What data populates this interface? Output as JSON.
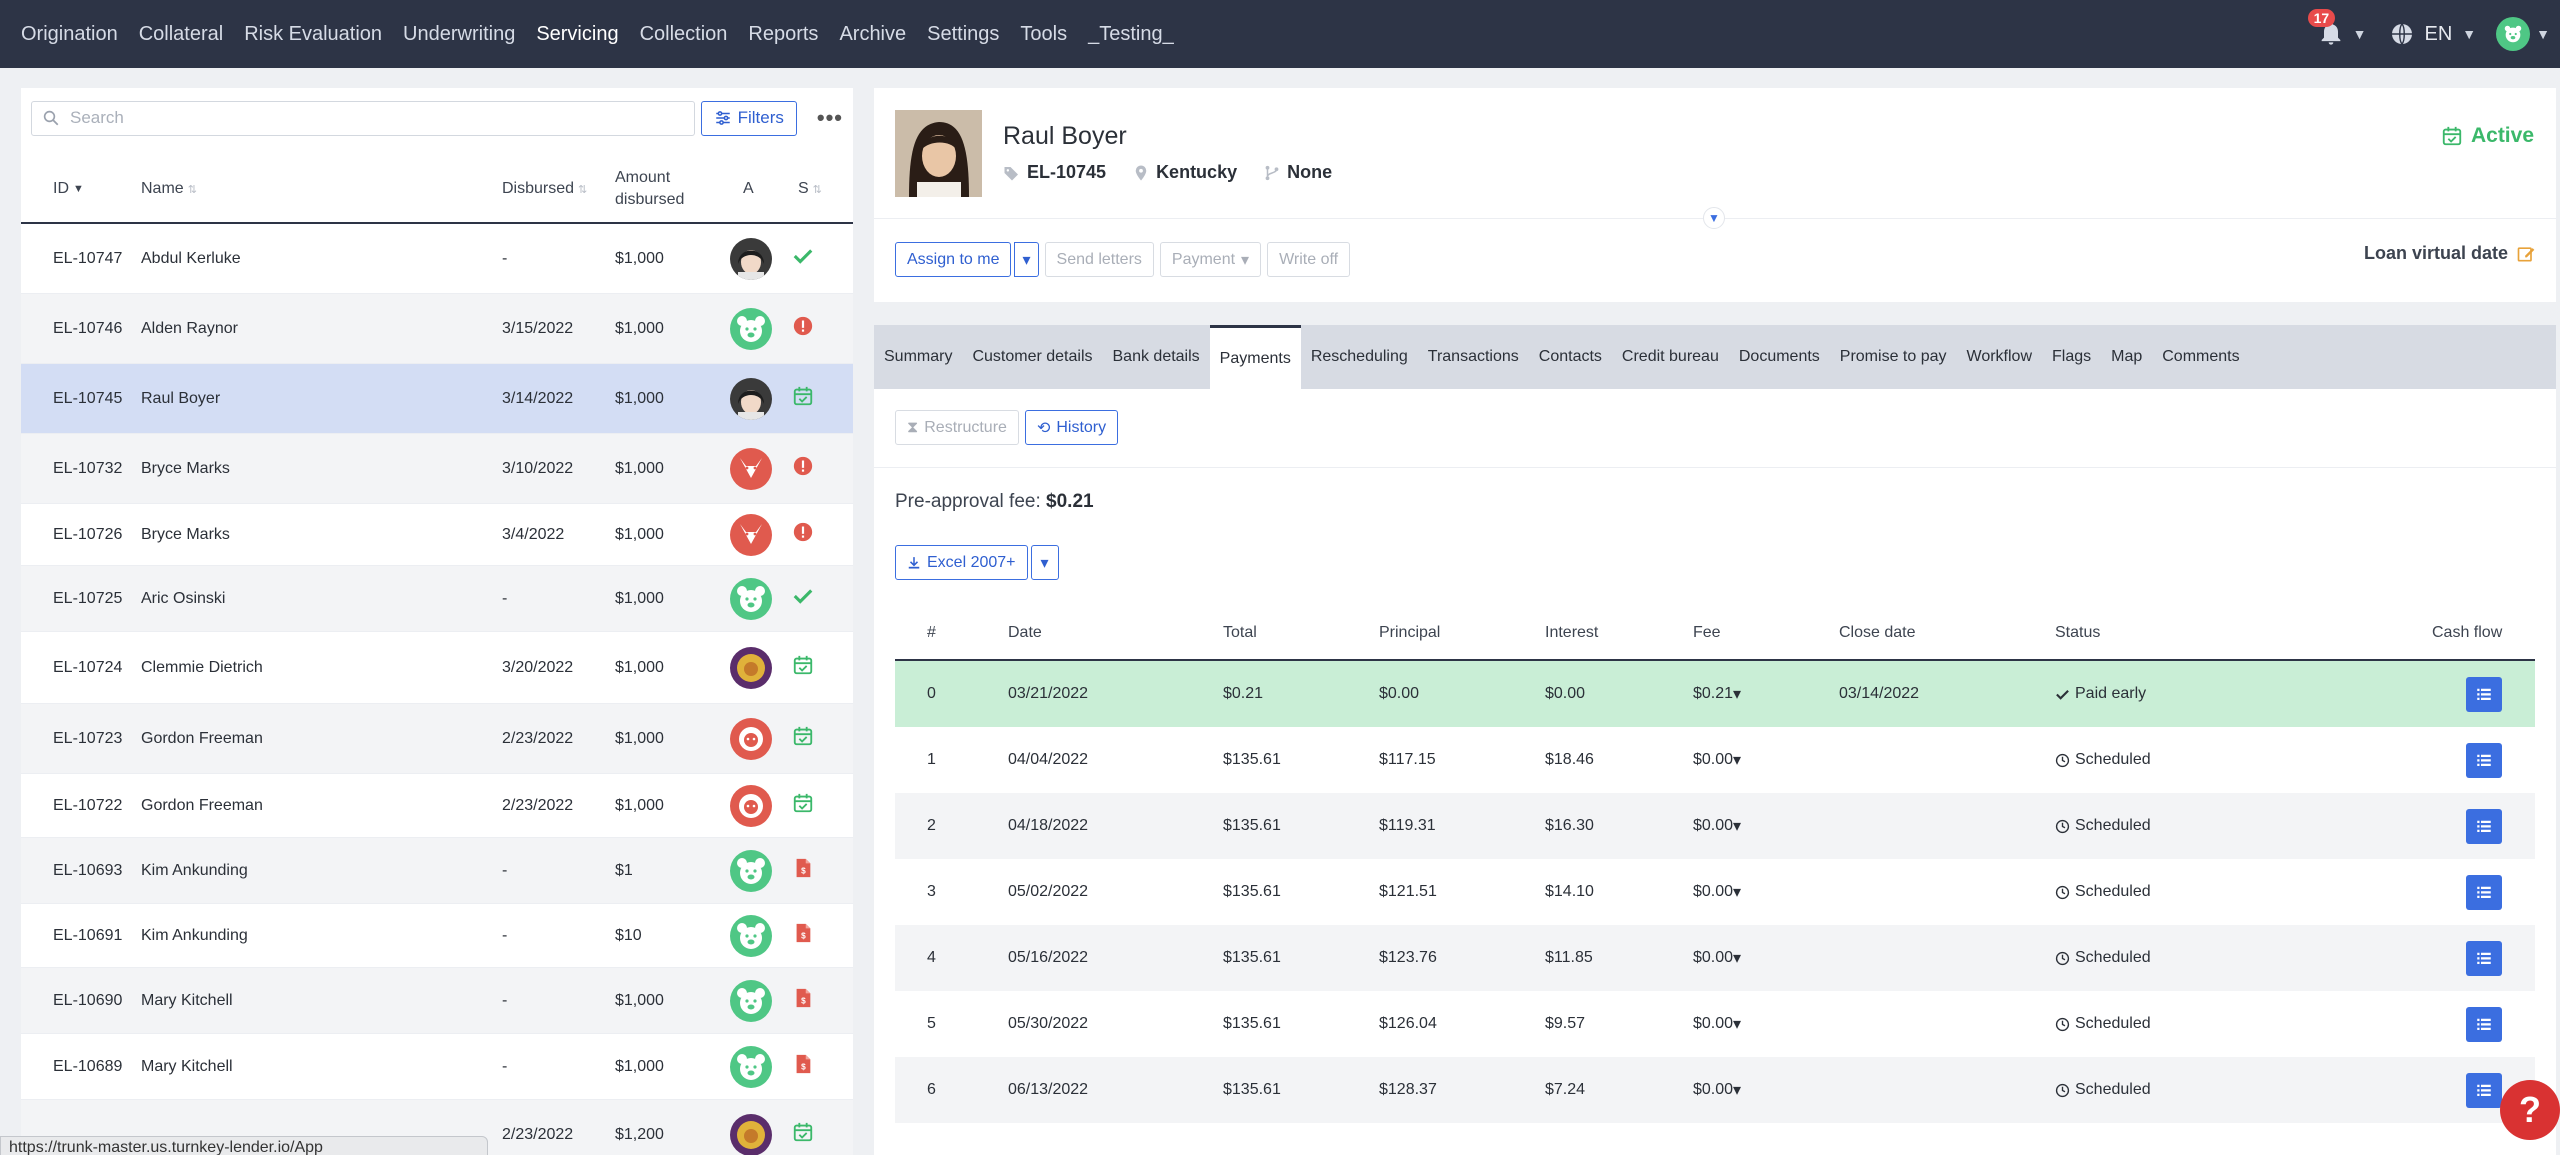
{
  "nav": {
    "items": [
      "Origination",
      "Collateral",
      "Risk Evaluation",
      "Underwriting",
      "Servicing",
      "Collection",
      "Reports",
      "Archive",
      "Settings",
      "Tools",
      "_Testing_"
    ],
    "active_index": 4,
    "notifications_count": "17",
    "language": "EN"
  },
  "search": {
    "placeholder": "Search",
    "filters_label": "Filters",
    "more_label": "•••"
  },
  "loan_table": {
    "headers": {
      "id": "ID",
      "name": "Name",
      "disbursed": "Disbursed",
      "amount": "Amount disbursed",
      "a": "A",
      "s": "S"
    },
    "rows": [
      {
        "id": "EL-10747",
        "name": "Abdul Kerluke",
        "disbursed": "-",
        "amount": "$1,000",
        "avatar": "person-dark",
        "status": "check"
      },
      {
        "id": "EL-10746",
        "name": "Alden Raynor",
        "disbursed": "3/15/2022",
        "amount": "$1,000",
        "avatar": "green-bear",
        "status": "alert"
      },
      {
        "id": "EL-10745",
        "name": "Raul Boyer",
        "disbursed": "3/14/2022",
        "amount": "$1,000",
        "avatar": "person-dark",
        "status": "calendar-check"
      },
      {
        "id": "EL-10732",
        "name": "Bryce Marks",
        "disbursed": "3/10/2022",
        "amount": "$1,000",
        "avatar": "red-fox",
        "status": "alert"
      },
      {
        "id": "EL-10726",
        "name": "Bryce Marks",
        "disbursed": "3/4/2022",
        "amount": "$1,000",
        "avatar": "red-fox",
        "status": "alert"
      },
      {
        "id": "EL-10725",
        "name": "Aric Osinski",
        "disbursed": "-",
        "amount": "$1,000",
        "avatar": "green-bear",
        "status": "check"
      },
      {
        "id": "EL-10724",
        "name": "Clemmie Dietrich",
        "disbursed": "3/20/2022",
        "amount": "$1,000",
        "avatar": "person-yellow",
        "status": "calendar-check"
      },
      {
        "id": "EL-10723",
        "name": "Gordon Freeman",
        "disbursed": "2/23/2022",
        "amount": "$1,000",
        "avatar": "red-lion",
        "status": "calendar-check"
      },
      {
        "id": "EL-10722",
        "name": "Gordon Freeman",
        "disbursed": "2/23/2022",
        "amount": "$1,000",
        "avatar": "red-lion",
        "status": "calendar-check"
      },
      {
        "id": "EL-10693",
        "name": "Kim Ankunding",
        "disbursed": "-",
        "amount": "$1",
        "avatar": "green-bear",
        "status": "document"
      },
      {
        "id": "EL-10691",
        "name": "Kim Ankunding",
        "disbursed": "-",
        "amount": "$10",
        "avatar": "green-bear",
        "status": "document"
      },
      {
        "id": "EL-10690",
        "name": "Mary Kitchell",
        "disbursed": "-",
        "amount": "$1,000",
        "avatar": "green-bear",
        "status": "document"
      },
      {
        "id": "EL-10689",
        "name": "Mary Kitchell",
        "disbursed": "-",
        "amount": "$1,000",
        "avatar": "green-bear",
        "status": "document"
      },
      {
        "id": "",
        "name": "",
        "disbursed": "2/23/2022",
        "amount": "$1,200",
        "avatar": "person-yellow",
        "status": "calendar-check"
      }
    ]
  },
  "status_url": "https://trunk-master.us.turnkey-lender.io/App",
  "customer": {
    "name": "Raul Boyer",
    "loan_id": "EL-10745",
    "location": "Kentucky",
    "branch": "None",
    "status": "Active",
    "assign_label": "Assign to me",
    "send_letters_label": "Send letters",
    "payment_label": "Payment",
    "write_off_label": "Write off",
    "loan_virtual_date_label": "Loan virtual date"
  },
  "tabs": [
    "Summary",
    "Customer details",
    "Bank details",
    "Payments",
    "Rescheduling",
    "Transactions",
    "Contacts",
    "Credit bureau",
    "Documents",
    "Promise to pay",
    "Workflow",
    "Flags",
    "Map",
    "Comments"
  ],
  "active_tab_index": 3,
  "payments": {
    "restructure_label": "Restructure",
    "history_label": "History",
    "fee_label": "Pre-approval fee:",
    "fee_value": "$0.21",
    "excel_label": "Excel 2007+",
    "headers": {
      "num": "#",
      "date": "Date",
      "total": "Total",
      "principal": "Principal",
      "interest": "Interest",
      "fee": "Fee",
      "close_date": "Close date",
      "status": "Status",
      "cash_flow": "Cash flow"
    },
    "rows": [
      {
        "num": "0",
        "date": "03/21/2022",
        "total": "$0.21",
        "principal": "$0.00",
        "interest": "$0.00",
        "fee": "$0.21",
        "close_date": "03/14/2022",
        "status": "Paid early",
        "state": "paid"
      },
      {
        "num": "1",
        "date": "04/04/2022",
        "total": "$135.61",
        "principal": "$117.15",
        "interest": "$18.46",
        "fee": "$0.00",
        "close_date": "",
        "status": "Scheduled",
        "state": "scheduled"
      },
      {
        "num": "2",
        "date": "04/18/2022",
        "total": "$135.61",
        "principal": "$119.31",
        "interest": "$16.30",
        "fee": "$0.00",
        "close_date": "",
        "status": "Scheduled",
        "state": "scheduled"
      },
      {
        "num": "3",
        "date": "05/02/2022",
        "total": "$135.61",
        "principal": "$121.51",
        "interest": "$14.10",
        "fee": "$0.00",
        "close_date": "",
        "status": "Scheduled",
        "state": "scheduled"
      },
      {
        "num": "4",
        "date": "05/16/2022",
        "total": "$135.61",
        "principal": "$123.76",
        "interest": "$11.85",
        "fee": "$0.00",
        "close_date": "",
        "status": "Scheduled",
        "state": "scheduled"
      },
      {
        "num": "5",
        "date": "05/30/2022",
        "total": "$135.61",
        "principal": "$126.04",
        "interest": "$9.57",
        "fee": "$0.00",
        "close_date": "",
        "status": "Scheduled",
        "state": "scheduled"
      },
      {
        "num": "6",
        "date": "06/13/2022",
        "total": "$135.61",
        "principal": "$128.37",
        "interest": "$7.24",
        "fee": "$0.00",
        "close_date": "",
        "status": "Scheduled",
        "state": "scheduled"
      }
    ]
  },
  "colors": {
    "nav_bg": "#2d3446",
    "accent": "#3b6ee0",
    "success": "#3bb86a",
    "danger": "#e05a4e",
    "selected_row": "#d3ddf4",
    "paid_row": "#c9eed6"
  }
}
